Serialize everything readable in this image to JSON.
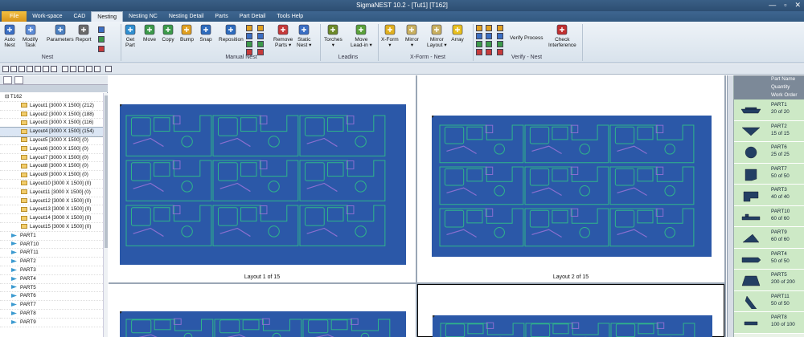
{
  "title_bar": {
    "title": "SigmaNEST 10.2 - [Tut1] [T162]",
    "minimize": "—",
    "maximize": "▫",
    "close": "✕"
  },
  "menu": {
    "tabs": [
      "File",
      "Work-space",
      "CAD",
      "Nesting",
      "Nesting NC",
      "Nesting Detail",
      "Parts",
      "Part Detail",
      "Tools Help"
    ],
    "active": "Nesting"
  },
  "ribbon": {
    "buttons": [
      {
        "label": "Auto\nNest",
        "icon": "auto-nest-icon",
        "color": "#3b6fc4"
      },
      {
        "label": "Modify\nTask",
        "icon": "modify-task-icon",
        "color": "#5b8bd6"
      },
      {
        "label": "Parameters",
        "icon": "parameters-icon",
        "color": "#4a7fbf"
      },
      {
        "label": "Report",
        "icon": "report-icon",
        "color": "#6a6a6a"
      },
      {
        "label": "Get\nPart",
        "icon": "get-part-icon",
        "color": "#2f8fd0"
      },
      {
        "label": "Move",
        "icon": "move-icon",
        "color": "#3c9a4a"
      },
      {
        "label": "Copy",
        "icon": "copy-icon",
        "color": "#3c9a4a"
      },
      {
        "label": "Bump",
        "icon": "bump-icon",
        "color": "#e0a020"
      },
      {
        "label": "Snap",
        "icon": "snap-icon",
        "color": "#2d6bbd"
      },
      {
        "label": "Reposition",
        "icon": "reposition-icon",
        "color": "#2d6bbd"
      },
      {
        "label": "Remove\nParts ▾",
        "icon": "remove-parts-icon",
        "color": "#c63a3a"
      },
      {
        "label": "Static\nNest ▾",
        "icon": "static-nest-icon",
        "color": "#3b6fc4"
      },
      {
        "label": "Torches\n▾",
        "icon": "torches-icon",
        "color": "#6d8a2a"
      },
      {
        "label": "Move\nLead-in ▾",
        "icon": "move-lead-in-icon",
        "color": "#5aa13a"
      },
      {
        "label": "X-Form\n▾",
        "icon": "x-form-icon",
        "color": "#e0b020"
      },
      {
        "label": "Mirror\n▾",
        "icon": "mirror-icon",
        "color": "#c9b060"
      },
      {
        "label": "Mirror\nLayout ▾",
        "icon": "mirror-layout-icon",
        "color": "#c9b060"
      },
      {
        "label": "Array",
        "icon": "array-icon",
        "color": "#e8c020"
      },
      {
        "label": "Check\nInterference",
        "icon": "check-interference-icon",
        "color": "#c03030"
      }
    ],
    "verify_process": "Verify Process",
    "groups": [
      "Nest",
      "Manual Nest",
      "Leadins",
      "X-Form - Nest",
      "Verify - Nest"
    ]
  },
  "tree": {
    "root": "T162",
    "layouts": [
      "Layout1 [3000 X 1500]  (212)",
      "Layout2 [3000 X 1500]  (188)",
      "Layout3 [3000 X 1500]  (116)",
      "Layout4 [3000 X 1500]  (154)",
      "Layout5 [3000 X 1500]  (0)",
      "Layout6 [3000 X 1500]  (0)",
      "Layout7 [3000 X 1500]  (0)",
      "Layout8 [3000 X 1500]  (0)",
      "Layout9 [3000 X 1500]  (0)",
      "Layout10 [3000 X 1500]  (0)",
      "Layout11 [3000 X 1500]  (0)",
      "Layout12 [3000 X 1500]  (0)",
      "Layout13 [3000 X 1500]  (0)",
      "Layout14 [3000 X 1500]  (0)",
      "Layout15 [3000 X 1500]  (0)"
    ],
    "parts": [
      "PART1",
      "PART10",
      "PART11",
      "PART2",
      "PART3",
      "PART4",
      "PART5",
      "PART6",
      "PART7",
      "PART8",
      "PART9"
    ]
  },
  "layouts": {
    "caption1": "Layout 1 of 15",
    "caption2": "Layout 2 of 15"
  },
  "parts_panel": {
    "headers": [
      "Part Name",
      "Quantity",
      "Work Order No."
    ],
    "rows": [
      {
        "name": "PART1",
        "qty": "20 of 20",
        "icon": "oval-part-icon"
      },
      {
        "name": "PART2",
        "qty": "15 of 15",
        "icon": "v-part-icon"
      },
      {
        "name": "PART6",
        "qty": "25 of 25",
        "icon": "flange-part-icon"
      },
      {
        "name": "PART7",
        "qty": "50 of 50",
        "icon": "block-part-icon"
      },
      {
        "name": "PART3",
        "qty": "40 of 40",
        "icon": "l-part-icon"
      },
      {
        "name": "PART10",
        "qty": "60 of 60",
        "icon": "strip-part-icon"
      },
      {
        "name": "PART9",
        "qty": "60 of 60",
        "icon": "wedge-part-icon"
      },
      {
        "name": "PART4",
        "qty": "50 of 50",
        "icon": "link-part-icon"
      },
      {
        "name": "PART5",
        "qty": "200 of 200",
        "icon": "trapezoid-part-icon"
      },
      {
        "name": "PART11",
        "qty": "50 of 50",
        "icon": "triangle-part-icon"
      },
      {
        "name": "PART8",
        "qty": "100 of 100",
        "icon": "bar-part-icon"
      }
    ]
  },
  "colors": {
    "sheet": "#2b58a8",
    "part_outline": "#2fb58a",
    "parts_bg": "#cde9c6"
  }
}
